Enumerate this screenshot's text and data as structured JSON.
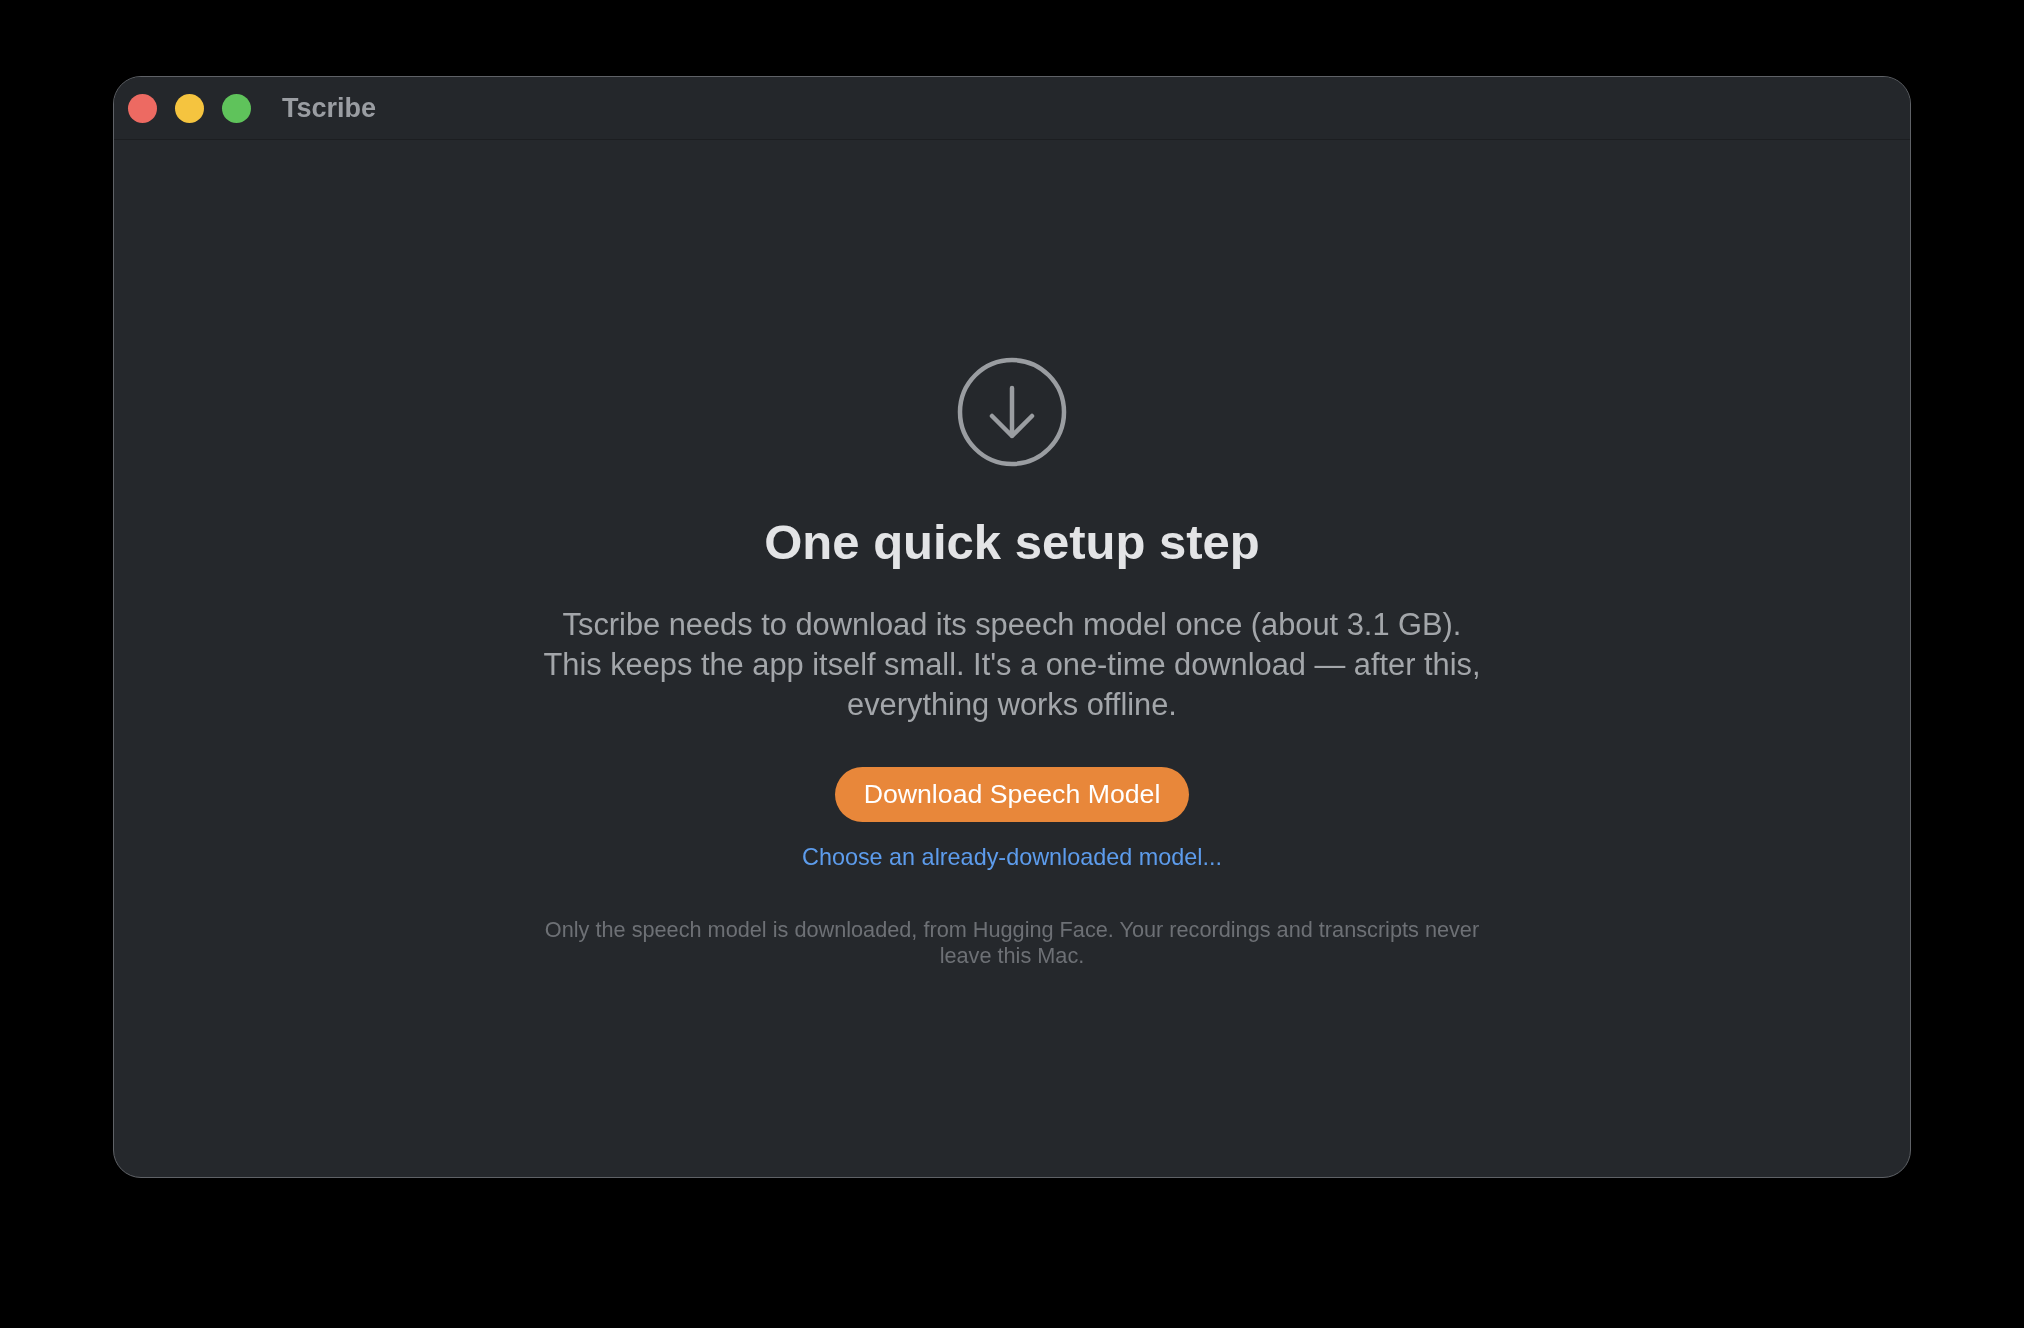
{
  "window": {
    "title": "Tscribe",
    "controls": [
      {
        "color": "#ed6a62"
      },
      {
        "color": "#f5c43f"
      },
      {
        "color": "#5fc35b"
      }
    ]
  },
  "setup": {
    "heading": "One quick setup step",
    "description": "Tscribe needs to download its speech model once (about 3.1 GB).\nThis keeps the app itself small. It's a one-time download — after this,\neverything works offline.",
    "primary_button": "Download Speech Model",
    "link": "Choose an already-downloaded model...",
    "footnote": "Only the speech model is downloaded, from Hugging Face. Your recordings and transcripts never\nleave this Mac."
  }
}
